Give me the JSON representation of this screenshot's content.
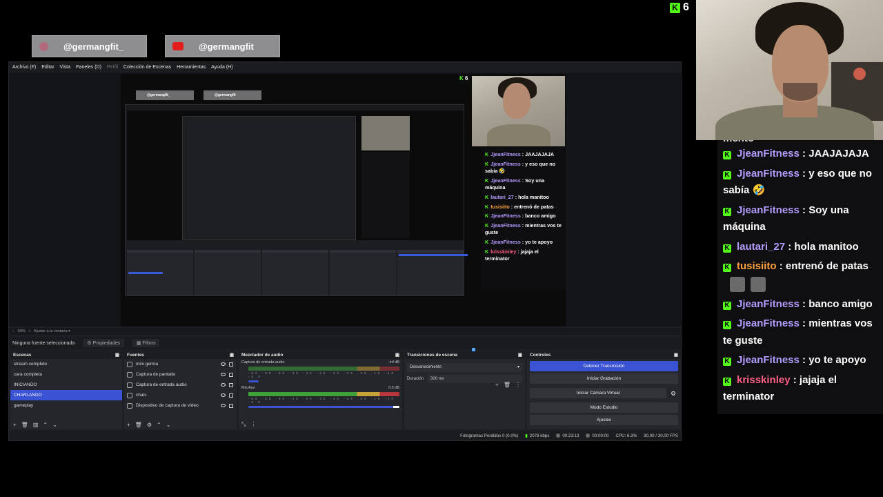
{
  "social": {
    "instagram": "@germangfit_",
    "youtube": "@germangfit"
  },
  "kick": {
    "count": "6"
  },
  "obs": {
    "menu": [
      "Archivo (F)",
      "Editar",
      "Vista",
      "Paneles (D)",
      "Perfil",
      "Colección de Escenas",
      "Herramientas",
      "Ayuda (H)"
    ],
    "zoom": "Ajustar a la ventana",
    "zoom_pct": "59%",
    "no_source": "Ninguna fuente seleccionada",
    "props_label": "Propiedades",
    "filters_label": "Filtros",
    "docks": {
      "scenes": "Escenas",
      "sources": "Fuentes",
      "mixer": "Mezclador de audio",
      "transitions": "Transiciones de escena",
      "controls": "Controles"
    },
    "scenes": [
      "stream completo",
      "cara completa",
      "INICIANDO",
      "CHARLANDO",
      "gameplay"
    ],
    "selected_scene": 3,
    "sources": [
      "mini germa",
      "Captura de pantalla",
      "Captura de entrada audio",
      "chats",
      "Dispositivo de captura de vídeo"
    ],
    "mixer": [
      {
        "name": "Captura de entrada audio",
        "db": "-inf dB"
      },
      {
        "name": "Mic/Aux",
        "db": "0.0 dB"
      }
    ],
    "meter_ticks": "-60 -55 -50 -45 -40 -35 -30 -25 -20 -15 -10 -5 0",
    "transition": "Desvanecimiento",
    "duration_label": "Duración",
    "duration_value": "300 ms",
    "controls": [
      "Detener Transmisión",
      "Iniciar Grabación",
      "Iniciar Cámara Virtual",
      "Modo Estudio",
      "Ajustes"
    ],
    "status": {
      "dropped": "Fotogramas Perdidos 0 (0,0%)",
      "bitrate": "2078 kbps",
      "live_time": "00:23:13",
      "rec_time": "00:00:00",
      "cpu": "CPU: 6,3%",
      "fps": "30,00 / 30,00 FPS"
    }
  },
  "chat": {
    "cut_text": "mento",
    "messages": [
      {
        "user": "JjeanFitness",
        "text": ": JAAJAJAJA",
        "color": "purple"
      },
      {
        "user": "JjeanFitness",
        "text": ": y eso que no sabía 🤣",
        "color": "purple"
      },
      {
        "user": "JjeanFitness",
        "text": ": Soy una máquina",
        "color": "purple"
      },
      {
        "user": "lautari_27",
        "text": ": hola manitoo",
        "color": "purple"
      },
      {
        "user": "tusisiito",
        "text": ": entrenó de patas",
        "color": "orange"
      },
      {
        "user": "JjeanFitness",
        "text": ": banco amigo",
        "color": "purple"
      },
      {
        "user": "JjeanFitness",
        "text": ": mientras vos te guste",
        "color": "purple"
      },
      {
        "user": "JjeanFitness",
        "text": ": yo te apoyo",
        "color": "purple"
      },
      {
        "user": "krisskinley",
        "text": ": jajaja el terminator",
        "color": "pink"
      }
    ],
    "mini_messages": [
      {
        "user": "JjeanFitness",
        "text": ": JAAJAJAJA"
      },
      {
        "user": "JjeanFitness",
        "text": ": y eso que no sabía 🤣"
      },
      {
        "user": "JjeanFitness",
        "text": ": Soy una máquina"
      },
      {
        "user": "lautari_27",
        "text": ": hola manitoo"
      },
      {
        "user": "tusisiito",
        "text": ": entrenó de patas"
      },
      {
        "user": "JjeanFitness",
        "text": ": banco amigo"
      },
      {
        "user": "JjeanFitness",
        "text": ": mientras vos te guste"
      },
      {
        "user": "JjeanFitness",
        "text": ": yo te apoyo"
      },
      {
        "user": "krisskinley",
        "text": ": jajaja el terminator"
      }
    ]
  }
}
